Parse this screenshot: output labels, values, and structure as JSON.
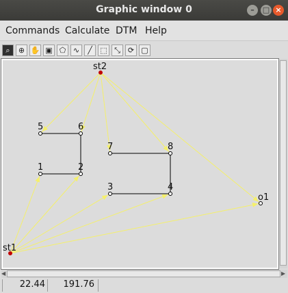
{
  "window": {
    "title": "Graphic window 0"
  },
  "menu": [
    "Commands",
    "Calculate",
    "DTM",
    "Help"
  ],
  "toolbar": [
    "zoom-tool-icon",
    "zoom-in-icon",
    "pan-hand-icon",
    "zoom-window-icon",
    "zoom-region-icon",
    "measure-icon",
    "line-tool-icon",
    "select-area-icon",
    "zoom-extents-icon",
    "refresh-icon",
    "clear-icon"
  ],
  "status": {
    "x": "22.44",
    "y": "191.76"
  },
  "colors": {
    "observation": "#f5f06a",
    "polygon": "#000000",
    "station": "#c00000"
  },
  "points": [
    {
      "id": "st2",
      "label": "st2",
      "type": "station"
    },
    {
      "id": "st1",
      "label": "st1",
      "type": "station"
    },
    {
      "id": "o1",
      "label": "o1",
      "type": "point"
    },
    {
      "id": "1",
      "label": "1",
      "type": "point"
    },
    {
      "id": "2",
      "label": "2",
      "type": "point"
    },
    {
      "id": "3",
      "label": "3",
      "type": "point"
    },
    {
      "id": "4",
      "label": "4",
      "type": "point"
    },
    {
      "id": "5",
      "label": "5",
      "type": "point"
    },
    {
      "id": "6",
      "label": "6",
      "type": "point"
    },
    {
      "id": "7",
      "label": "7",
      "type": "point"
    },
    {
      "id": "8",
      "label": "8",
      "type": "point"
    }
  ],
  "observations": [
    [
      "st2",
      "5"
    ],
    [
      "st2",
      "6"
    ],
    [
      "st2",
      "7"
    ],
    [
      "st2",
      "8"
    ],
    [
      "st2",
      "o1"
    ],
    [
      "st1",
      "1"
    ],
    [
      "st1",
      "2"
    ],
    [
      "st1",
      "3"
    ],
    [
      "st1",
      "4"
    ],
    [
      "st1",
      "o1"
    ]
  ],
  "polylines": [
    [
      "5",
      "6",
      "2",
      "1"
    ],
    [
      "7",
      "8",
      "4",
      "3"
    ]
  ]
}
